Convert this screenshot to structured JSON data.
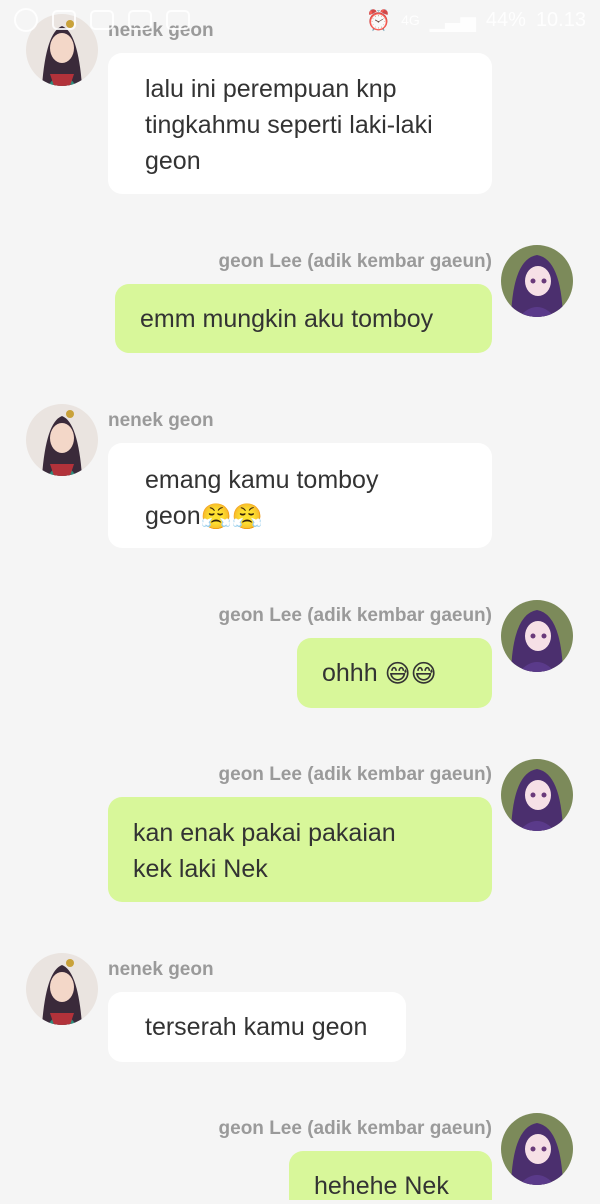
{
  "status_bar": {
    "network": "4G",
    "battery": "44%",
    "time": "10.13"
  },
  "participants": {
    "grandma": "nenek geon",
    "geon": "geon Lee (adik kembar gaeun)"
  },
  "messages": [
    {
      "sender": "nenek geon",
      "text": "lalu ini perempuan knp\ntingkahmu seperti laki-laki\ngeon"
    },
    {
      "sender": "geon Lee (adik kembar gaeun)",
      "text": "emm mungkin aku tomboy"
    },
    {
      "sender": "nenek geon",
      "text": "emang kamu tomboy\ngeon",
      "emoji": "😤😤"
    },
    {
      "sender": "geon Lee (adik kembar gaeun)",
      "text": "ohhh ",
      "emoji": "😅😅"
    },
    {
      "sender": "geon Lee (adik kembar gaeun)",
      "text": "kan enak pakai pakaian\nkek laki Nek"
    },
    {
      "sender": "nenek geon",
      "text": "terserah kamu geon"
    },
    {
      "sender": "geon Lee (adik kembar gaeun)",
      "text": "hehehe Nek"
    }
  ],
  "colors": {
    "background": "#f5f5f5",
    "incoming_bubble": "#ffffff",
    "outgoing_bubble": "#d8f79a",
    "sender_name": "#9a9a9a",
    "message_text": "#333333"
  }
}
